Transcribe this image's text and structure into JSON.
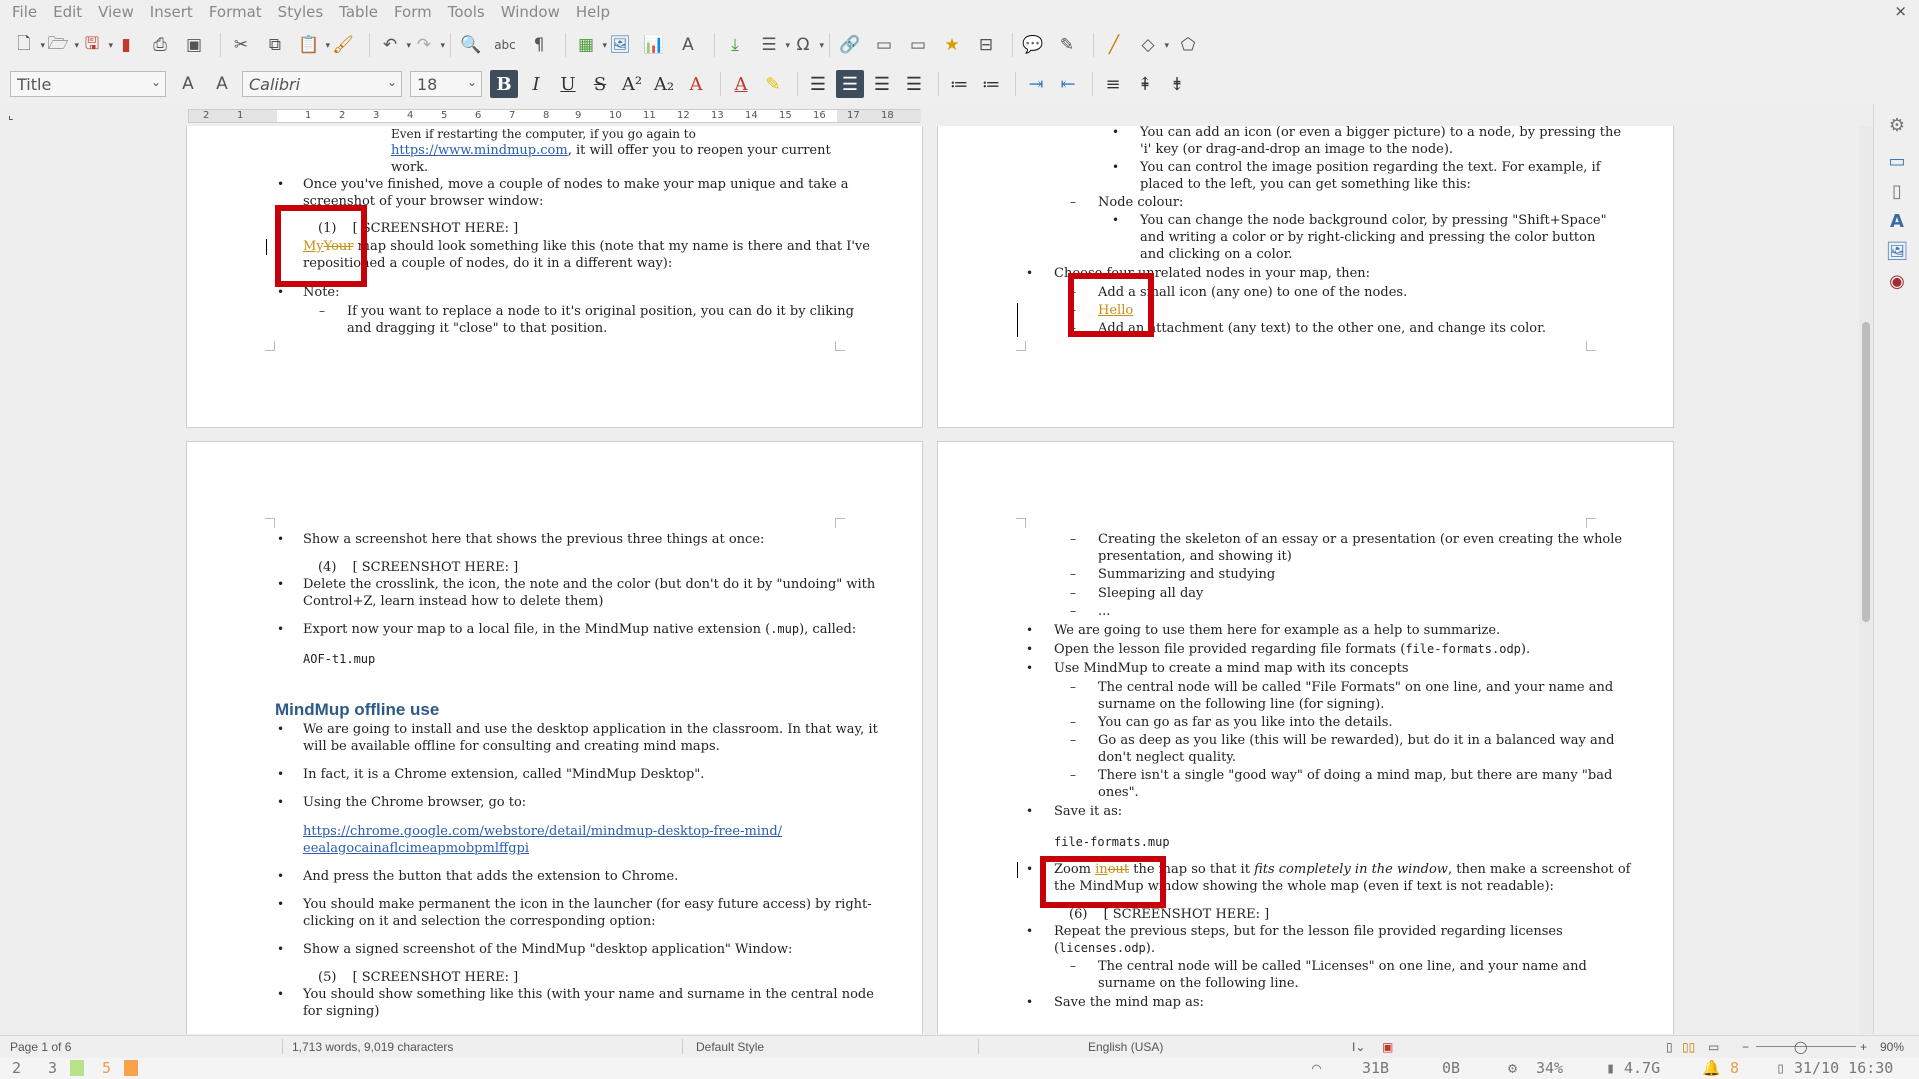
{
  "menubar": {
    "items": [
      "File",
      "Edit",
      "View",
      "Insert",
      "Format",
      "Styles",
      "Table",
      "Form",
      "Tools",
      "Window",
      "Help"
    ],
    "close_label": "×"
  },
  "toolbar1": {
    "icons": [
      "new-document-icon",
      "open-folder-icon",
      "save-icon",
      "export-pdf-icon",
      "print-icon",
      "print-preview-icon",
      "cut-icon",
      "copy-icon",
      "paste-icon",
      "clone-formatting-icon",
      "undo-icon",
      "redo-icon",
      "find-replace-icon",
      "spellcheck-icon",
      "formatting-marks-icon",
      "insert-table-icon",
      "insert-image-icon",
      "insert-chart-icon",
      "insert-textbox-icon",
      "page-break-icon",
      "insert-field-icon",
      "special-character-icon",
      "hyperlink-icon",
      "footnote-icon",
      "endnote-icon",
      "bookmark-icon",
      "cross-reference-icon",
      "comment-icon",
      "track-changes-icon",
      "line-icon",
      "basic-shapes-icon",
      "draw-shapes-icon"
    ]
  },
  "toolbar2": {
    "paragraph_style": "Title",
    "font_name": "Calibri",
    "font_size": "18"
  },
  "ruler": {
    "labels": [
      "2",
      "1",
      "1",
      "2",
      "3",
      "4",
      "5",
      "6",
      "7",
      "8",
      "9",
      "10",
      "11",
      "12",
      "13",
      "14",
      "15",
      "16",
      "17",
      "18"
    ]
  },
  "pages": {
    "p1": {
      "lines": [
        "Even if restarting the computer, if you go again to",
        "https://www.mindmup.com",
        ", it will offer you to reopen your current",
        "work.",
        "Once you've finished, move a couple of nodes to make your map unique and take a",
        "screenshot of your browser window:",
        "(1)",
        "[ SCREENSHOT HERE: ]",
        "My",
        "Your",
        " map should look something like this (note that my name is there and that I've",
        "repositioned a couple of nodes, do it in a different way):",
        "Note:",
        "If you want to replace a node to it's original position, you can do it by cliking",
        "and dragging it \"close\" to that position."
      ]
    },
    "p2": {
      "lines": [
        "You can add an icon (or even a bigger picture) to a node, by pressing the",
        "'i' key (or drag-and-drop an image to the node).",
        "You can control the image position regarding the text. For example, if",
        "placed to the left, you can get something like this:",
        "Node colour:",
        "You can change the node background color, by pressing \"Shift+Space\"",
        "and writing a color or by right-clicking and pressing the color button",
        "and clicking on a color.",
        "Choose four unrelated nodes in your map, then:",
        "Add a small icon (any one) to one of the nodes.",
        "Hello",
        "Add an attachment (any text) to the other one, and change its color."
      ]
    },
    "p3": {
      "lines": [
        "Show a screenshot here that shows the previous three things at once:",
        "(4)",
        "[ SCREENSHOT HERE: ]",
        "Delete the crosslink, the icon, the note and the color (but don't do it by \"undoing\" with",
        "Control+Z, learn instead how to delete them)",
        "Export now your map to a local file, in the MindMup native extension (",
        ".mup",
        "), called:",
        "AOF-t1.mup",
        "MindMup offline use",
        "We are going to install and use the desktop application in the classroom. In that way, it",
        "will be available offline for consulting and creating mind maps.",
        "In fact, it is a Chrome extension, called \"MindMup Desktop\".",
        "Using the Chrome browser, go to:",
        "https://chrome.google.com/webstore/detail/mindmup-desktop-free-mind/",
        "eealagocainaflcimeapmobpmlffgpi",
        "And press the button that adds the extension to Chrome.",
        "You should make permanent the icon in the launcher (for easy future access) by right-",
        "clicking on it and selection the corresponding option:",
        "Show a signed screenshot of the MindMup \"desktop application\" Window:",
        "(5)",
        "[ SCREENSHOT HERE: ]",
        "You should show something like this (with your name and surname in the central node",
        "for signing)"
      ]
    },
    "p4": {
      "lines": [
        "Creating the skeleton of an essay or a presentation (or even creating the whole",
        "presentation, and showing it)",
        "Summarizing and studying",
        "Sleeping all day",
        "...",
        "We are going to use them here for example as a help to summarize.",
        "Open the lesson file provided regarding file formats (",
        "file-formats.odp",
        ").",
        "Use MindMup to create a mind map with its concepts",
        "The central node will be called \"File Formats\" on one line, and your name and",
        "surname on the following line (for signing).",
        "You can go as far as you like into the details.",
        "Go as deep as you like (this will be rewarded), but do it in a balanced way and",
        "don't neglect quality.",
        "There isn't a single \"good way\" of doing a mind map, but there are many \"bad",
        "ones\".",
        "Save it as:",
        "file-formats.mup",
        "Zoom ",
        "in",
        "out",
        " the map so that it ",
        "fits completely in the window",
        ", then make a screenshot of",
        "the MindMup window showing the whole map (even if text is not readable):",
        "(6)",
        "[ SCREENSHOT HERE: ]",
        "Repeat the previous steps, but for the lesson file provided regarding licenses",
        "(",
        "licenses.odp",
        ").",
        "The central node will be called \"Licenses\" on one line, and your name and",
        "surname on the following line.",
        "Save the mind map as:"
      ]
    }
  },
  "statusbar": {
    "page": "Page 1 of 6",
    "words": "1,713 words, 9,019 characters",
    "style": "Default Style",
    "language": "English (USA)",
    "zoom": "90%"
  },
  "taskbar": {
    "workspaces": [
      "2",
      "3",
      "4",
      "5",
      "6"
    ],
    "net_down": "31B",
    "net_up": "0B",
    "cpu": "34%",
    "disk": "4.7G",
    "notifications": "8",
    "datetime": "31/10 16:30"
  },
  "colors": {
    "accent_red_box": "#c8000a",
    "tracked_change": "#c78f16",
    "heading_blue": "#2e5a88",
    "link_blue": "#2a5db0"
  }
}
